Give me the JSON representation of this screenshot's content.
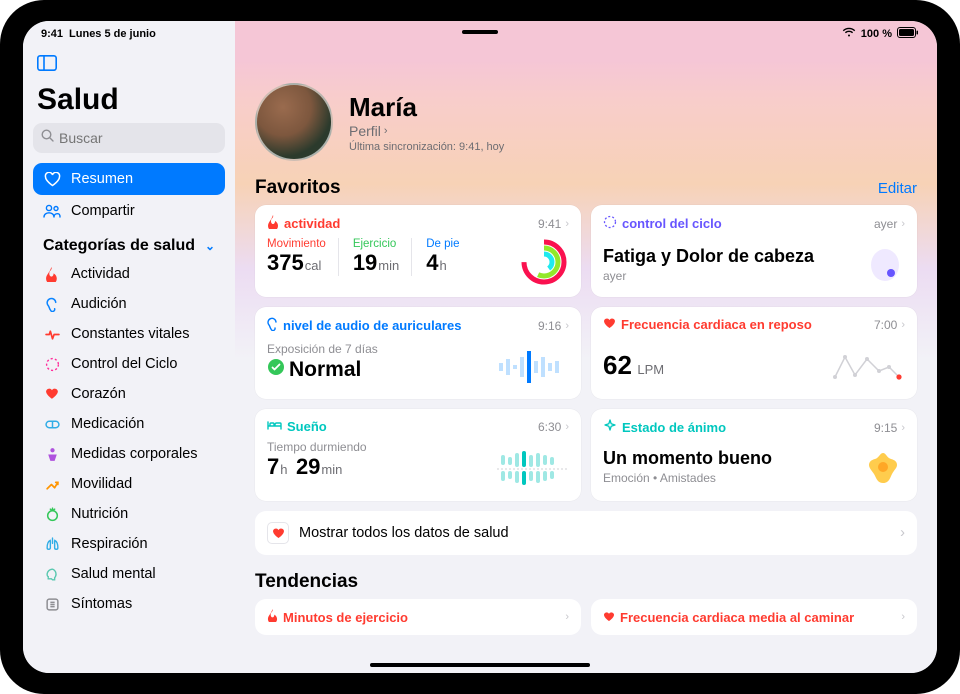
{
  "status": {
    "time": "9:41",
    "date": "Lunes 5 de junio",
    "battery": "100 %"
  },
  "sidebar": {
    "title": "Salud",
    "search_placeholder": "Buscar",
    "summary": "Resumen",
    "share": "Compartir",
    "categories_title": "Categorías de salud",
    "cats": [
      {
        "label": "Actividad",
        "color": "#ff3b30",
        "icon": "flame"
      },
      {
        "label": "Audición",
        "color": "#0a84ff",
        "icon": "ear"
      },
      {
        "label": "Constantes vitales",
        "color": "#ff3b30",
        "icon": "vitals"
      },
      {
        "label": "Control del Ciclo",
        "color": "#ff2d9b",
        "icon": "cycle"
      },
      {
        "label": "Corazón",
        "color": "#ff3b30",
        "icon": "heart"
      },
      {
        "label": "Medicación",
        "color": "#32ade6",
        "icon": "pill"
      },
      {
        "label": "Medidas corporales",
        "color": "#af52de",
        "icon": "body"
      },
      {
        "label": "Movilidad",
        "color": "#ff9500",
        "icon": "mobility"
      },
      {
        "label": "Nutrición",
        "color": "#34c759",
        "icon": "nutrition"
      },
      {
        "label": "Respiración",
        "color": "#32ade6",
        "icon": "lungs"
      },
      {
        "label": "Salud mental",
        "color": "#5ac8b0",
        "icon": "mental"
      },
      {
        "label": "Síntomas",
        "color": "#8e8e93",
        "icon": "symptoms"
      }
    ]
  },
  "profile": {
    "name": "María",
    "link": "Perfil",
    "sync": "Última sincronización: 9:41, hoy"
  },
  "favorites": {
    "title": "Favoritos",
    "edit": "Editar",
    "activity": {
      "title": "actividad",
      "time": "9:41",
      "move_label": "Movimiento",
      "move_val": "375",
      "move_unit": "cal",
      "ex_label": "Ejercicio",
      "ex_val": "19",
      "ex_unit": "min",
      "stand_label": "De pie",
      "stand_val": "4",
      "stand_unit": "h"
    },
    "cycle": {
      "title": "control del ciclo",
      "time": "ayer",
      "main": "Fatiga y Dolor de cabeza",
      "sub": "ayer"
    },
    "audio": {
      "title": "nivel de audio de auriculares",
      "time": "9:16",
      "sub": "Exposición de 7 días",
      "main": "Normal"
    },
    "heart": {
      "title": "Frecuencia cardiaca en reposo",
      "time": "7:00",
      "val": "62",
      "unit": "LPM"
    },
    "sleep": {
      "title": "Sueño",
      "time": "6:30",
      "sub": "Tiempo durmiendo",
      "h": "7",
      "hlabel": "h",
      "m": "29",
      "mlabel": "min"
    },
    "mood": {
      "title": "Estado de ánimo",
      "time": "9:15",
      "main": "Un momento bueno",
      "sub": "Emoción  •  Amistades"
    },
    "show_all": "Mostrar todos los datos de salud"
  },
  "trends": {
    "title": "Tendencias",
    "items": [
      {
        "label": "Minutos de ejercicio",
        "color": "#ff3b30"
      },
      {
        "label": "Frecuencia cardiaca media al caminar",
        "color": "#ff3b30"
      }
    ]
  }
}
